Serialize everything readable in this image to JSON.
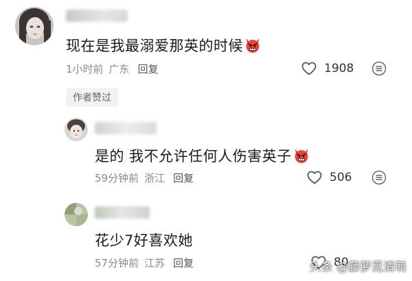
{
  "comments": [
    {
      "text": "现在是我最溺爱那英的时候",
      "time": "1小时前",
      "location": "广东",
      "reply_label": "回复",
      "likes": "1908",
      "badge": "作者赞过"
    },
    {
      "text": "是的 我不允许任何人伤害英子",
      "time": "59分钟前",
      "location": "浙江",
      "reply_label": "回复",
      "likes": "506"
    },
    {
      "text": "花少7好喜欢她",
      "time": "57分钟前",
      "location": "江苏",
      "reply_label": "回复",
      "likes": "80"
    }
  ],
  "watermark": "头条 @藤萝觅清萌",
  "colors": {
    "meta_gray": "#8a8a8a",
    "badge_bg": "#f2f2f2",
    "devil_emoji": "#e8453c"
  },
  "icons": [
    "heart-outline-icon",
    "more-options-icon",
    "devil-face-emoji"
  ]
}
